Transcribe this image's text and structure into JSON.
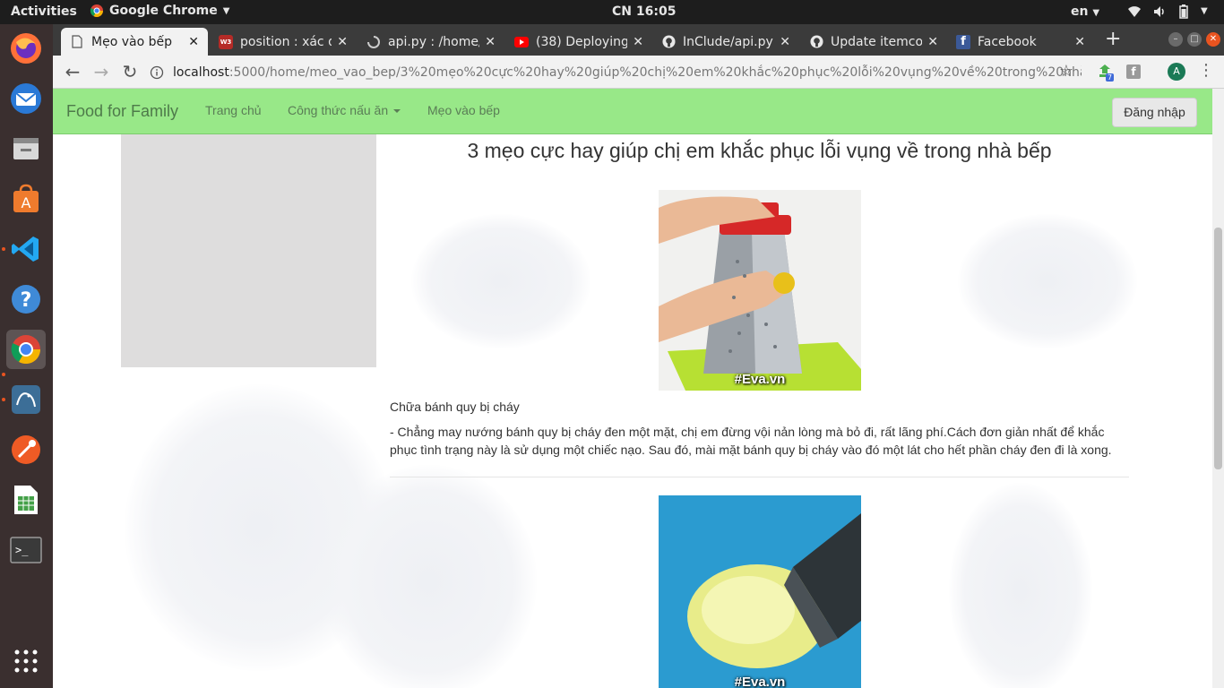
{
  "system": {
    "activities": "Activities",
    "app_name": "Google Chrome",
    "clock": "CN 16:05",
    "lang": "en"
  },
  "dock": {
    "items": [
      "firefox-icon",
      "thunderbird-icon",
      "files-icon",
      "software-icon",
      "vscode-icon",
      "help-icon",
      "chrome-icon",
      "mysql-workbench-icon",
      "postman-icon",
      "spreadsheet-icon",
      "terminal-icon",
      "app-grid-icon"
    ]
  },
  "browser": {
    "tabs": [
      {
        "title": "Mẹo vào bếp",
        "favicon": "page-icon"
      },
      {
        "title": "position : xác đ",
        "favicon": "site-icon"
      },
      {
        "title": "api.py : /home/",
        "favicon": "loading-icon"
      },
      {
        "title": "(38) Deploying",
        "favicon": "youtube-icon"
      },
      {
        "title": "InClude/api.py",
        "favicon": "github-icon"
      },
      {
        "title": "Update itemco",
        "favicon": "github-icon"
      },
      {
        "title": "Facebook",
        "favicon": "facebook-icon"
      }
    ],
    "url_host": "localhost",
    "url_path": ":5000/home/meo_vao_bep/3%20mẹo%20cực%20hay%20giúp%20chị%20em%20khắc%20phục%20lỗi%20vụng%20về%20trong%20nhà...",
    "profile_initial": "A",
    "extension_badge": "7"
  },
  "site": {
    "brand": "Food for Family",
    "nav": {
      "home": "Trang chủ",
      "recipes": "Công thức nấu ăn",
      "tips": "Mẹo vào bếp"
    },
    "login": "Đăng nhập"
  },
  "article": {
    "title": "3 mẹo cực hay giúp chị em khắc phục lỗi vụng về trong nhà bếp",
    "image_caption": "#Eva.vn",
    "tip1_heading": "Chữa bánh quy bị cháy",
    "tip1_body": "- Chẳng may nướng bánh quy bị cháy đen một mặt, chị em đừng vội nản lòng mà bỏ đi, rất lãng phí.Cách đơn giản nhất để khắc phục tình trạng này là sử dụng một chiếc nạo. Sau đó, mài mặt bánh quy bị cháy vào đó một lát cho hết phần cháy đen đi là xong."
  },
  "colors": {
    "navbar": "#98e888",
    "topbar": "#1d1d1d",
    "dock": "#3a2f2f",
    "accent": "#e95420"
  }
}
